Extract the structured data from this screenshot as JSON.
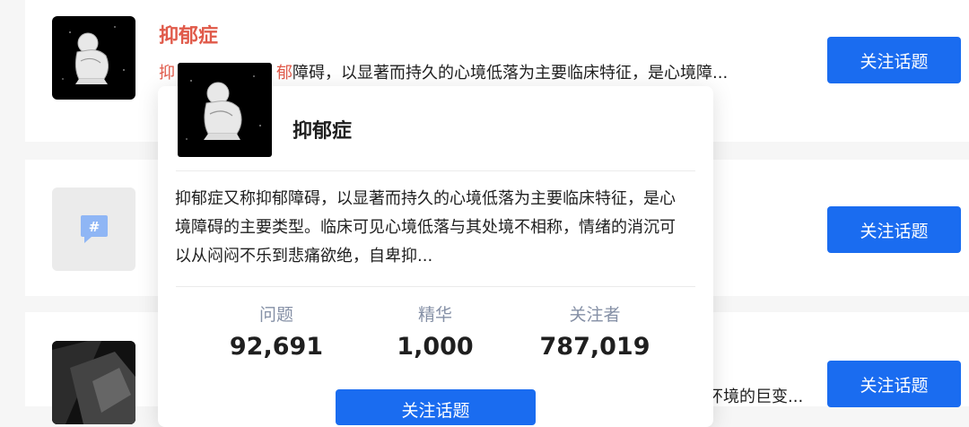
{
  "topics": [
    {
      "title": "抑郁症",
      "excerpt_highlight_1": "抑",
      "excerpt_highlight_2": "郁",
      "excerpt_rest": "障碍，以显著而持久的心境低落为主要临床特征，是心境障...",
      "follow_label": "关注话题"
    },
    {
      "follow_label": "关注话题"
    },
    {
      "excerpt_tail": "环境的巨变...",
      "follow_label": "关注话题"
    }
  ],
  "popover": {
    "name": "抑郁症",
    "description": "抑郁症又称抑郁障碍，以显著而持久的心境低落为主要临床特征，是心境障碍的主要类型。临床可见心境低落与其处境不相称，情绪的消沉可以从闷闷不乐到悲痛欲绝，自卑抑...",
    "stats": [
      {
        "label": "问题",
        "value": "92,691"
      },
      {
        "label": "精华",
        "value": "1,000"
      },
      {
        "label": "关注者",
        "value": "787,019"
      }
    ],
    "follow_label": "关注话题"
  },
  "colors": {
    "accent": "#1a6cf0",
    "highlight": "#e05a4a"
  }
}
